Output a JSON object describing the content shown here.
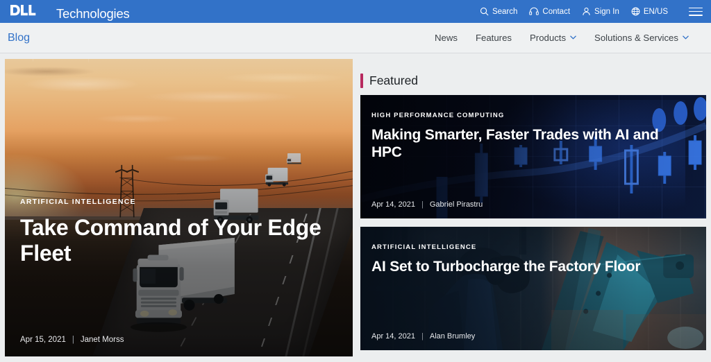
{
  "topbar": {
    "brand_mark": "DELL",
    "brand_word": "Technologies",
    "utilities": [
      {
        "label": "Search",
        "icon": "search-icon"
      },
      {
        "label": "Contact",
        "icon": "headset-icon"
      },
      {
        "label": "Sign In",
        "icon": "person-icon"
      },
      {
        "label": "EN/US",
        "icon": "globe-icon"
      }
    ],
    "menu_icon": "hamburger-menu-icon",
    "background": "#3272c8"
  },
  "subnav": {
    "brand": "Blog",
    "brand_color": "#3272c8",
    "links": [
      {
        "label": "News",
        "has_dropdown": false
      },
      {
        "label": "Features",
        "has_dropdown": false
      },
      {
        "label": "Products",
        "has_dropdown": true
      },
      {
        "label": "Solutions & Services",
        "has_dropdown": true
      }
    ]
  },
  "hero": {
    "category": "ARTIFICIAL INTELLIGENCE",
    "title": "Take Command of Your Edge Fleet",
    "date": "Apr 15, 2021",
    "separator": "|",
    "author": "Janet Morss",
    "image_alt": "Trucks driving on a highway at sunset"
  },
  "featured": {
    "heading": "Featured",
    "accent_color": "#b7295e",
    "cards": [
      {
        "category": "HIGH PERFORMANCE COMPUTING",
        "title": "Making Smarter, Faster Trades with AI and HPC",
        "date": "Apr 14, 2021",
        "separator": "|",
        "author": "Gabriel Pirastru",
        "image_alt": "Blue candlestick stock trading chart"
      },
      {
        "category": "ARTIFICIAL INTELLIGENCE",
        "title": "AI Set to Turbocharge the Factory Floor",
        "date": "Apr 14, 2021",
        "separator": "|",
        "author": "Alan Brumley",
        "image_alt": "Factory worker beside a robotic arm"
      }
    ]
  }
}
